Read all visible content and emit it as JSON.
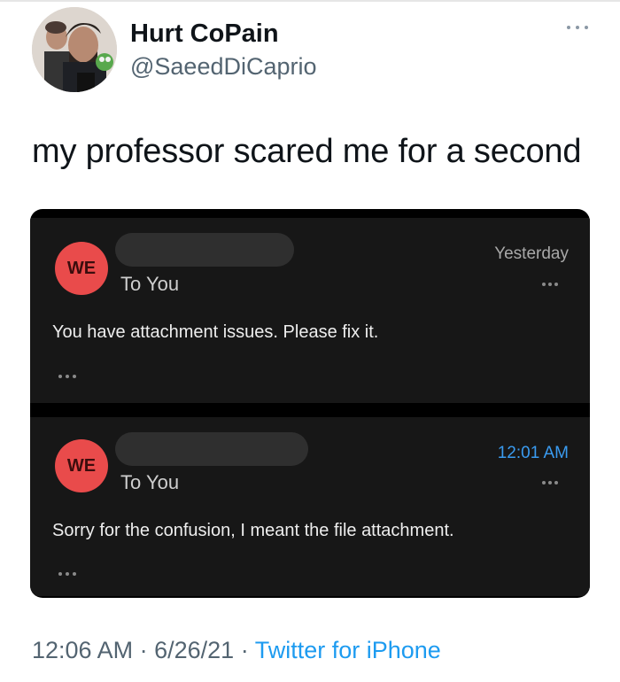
{
  "author": {
    "display_name": "Hurt CoPain",
    "handle": "@SaeedDiCaprio"
  },
  "tweet": {
    "text": "my professor scared me for a second"
  },
  "emails": [
    {
      "avatar_initials": "WE",
      "recipient": "To You",
      "date": "Yesterday",
      "message": "You have attachment issues. Please fix it."
    },
    {
      "avatar_initials": "WE",
      "recipient": "To You",
      "date": "12:01 AM",
      "message": "Sorry for the confusion, I meant the file attachment."
    }
  ],
  "meta": {
    "time": "12:06 AM",
    "separator": "·",
    "date": "6/26/21",
    "source": "Twitter for iPhone"
  },
  "colors": {
    "avatar_red": "#e94b4b",
    "link_blue": "#1d9bf0",
    "time_blue": "#3a9bf0",
    "email_background": "#171717"
  },
  "icons": {
    "tweet_more": "more-horizontal-icon",
    "email_more": "more-horizontal-icon",
    "expand_message": "ellipsis-icon"
  }
}
